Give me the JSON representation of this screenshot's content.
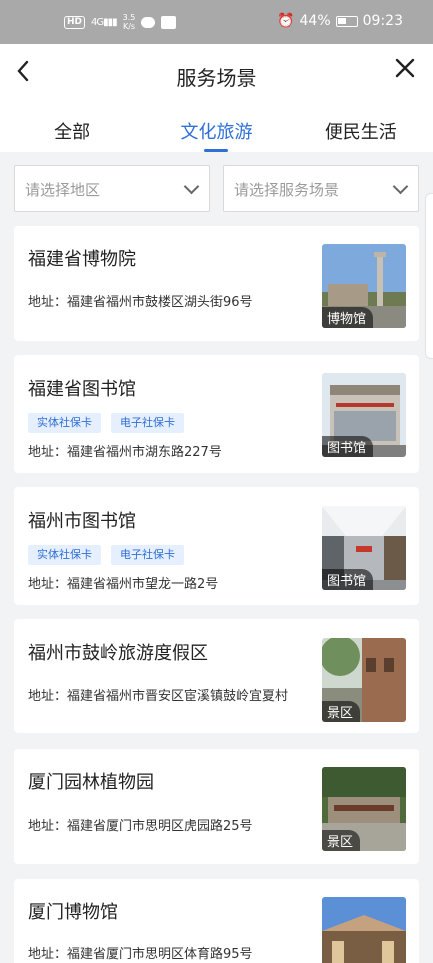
{
  "status_bar": {
    "network_badge": "HD",
    "network_type": "4G",
    "speed_value": "3.5",
    "speed_unit": "K/s",
    "battery": "44%",
    "time": "09:23"
  },
  "header": {
    "back_icon": "chevron-left-icon",
    "title": "服务场景",
    "close_icon": "close-icon"
  },
  "tabs": [
    {
      "label": "全部",
      "active": false
    },
    {
      "label": "文化旅游",
      "active": true
    },
    {
      "label": "便民生活",
      "active": false
    }
  ],
  "filters": {
    "region_placeholder": "请选择地区",
    "scene_placeholder": "请选择服务场景"
  },
  "places": [
    {
      "name": "福建省博物院",
      "tags": [],
      "address": "地址：福建省福州市鼓楼区湖头街96号",
      "category": "博物馆"
    },
    {
      "name": "福建省图书馆",
      "tags": [
        "实体社保卡",
        "电子社保卡"
      ],
      "address": "地址：福建省福州市湖东路227号",
      "category": "图书馆"
    },
    {
      "name": "福州市图书馆",
      "tags": [
        "实体社保卡",
        "电子社保卡"
      ],
      "address": "地址：福建省福州市望龙一路2号",
      "category": "图书馆"
    },
    {
      "name": "福州市鼓岭旅游度假区",
      "tags": [],
      "address": "地址：福建省福州市晋安区宦溪镇鼓岭宜夏村",
      "category": "景区"
    },
    {
      "name": "厦门园林植物园",
      "tags": [],
      "address": "地址：福建省厦门市思明区虎园路25号",
      "category": "景区"
    },
    {
      "name": "厦门博物馆",
      "tags": [],
      "address": "地址：福建省厦门市思明区体育路95号",
      "category": ""
    }
  ],
  "colors": {
    "accent": "#2f6fd8",
    "tag_bg": "#e6effd",
    "status_bar": "#a9a9a9",
    "page_bg": "#f2f3f5"
  }
}
